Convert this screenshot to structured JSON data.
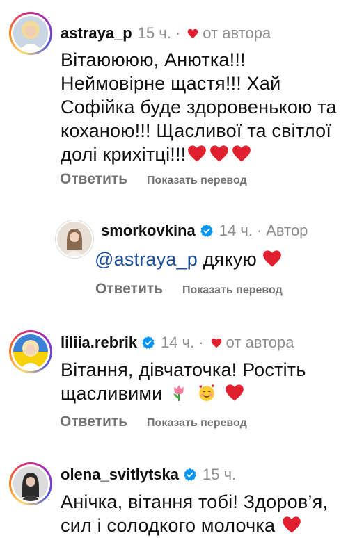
{
  "comments": [
    {
      "username": "astraya_p",
      "verified": false,
      "time": "15 ч.",
      "separator": "·",
      "tag": "от автора",
      "lines": [
        "Вітаюююю, Анютка!!!",
        "Неймовірне щастя!!! Хай",
        "Софійка буде здоровенькою та",
        "коханою!!! Щасливої та світлої",
        "долі крихітці!!!"
      ],
      "reply_label": "Ответить",
      "translate_label": "Показать перевод"
    },
    {
      "username": "smorkovkina",
      "verified": true,
      "time": "14 ч.",
      "separator": "·",
      "tag": "Автор",
      "mention": "@astraya_p",
      "text": "дякую",
      "reply_label": "Ответить",
      "translate_label": "Показать перевод"
    },
    {
      "username": "liliia.rebrik",
      "verified": true,
      "time": "14 ч.",
      "separator": "·",
      "tag": "от автора",
      "lines": [
        "Вітання, дівчаточка! Ростіть",
        "щасливими"
      ],
      "reply_label": "Ответить",
      "translate_label": "Показать перевод"
    },
    {
      "username": "olena_svitlytska",
      "verified": true,
      "time": "15 ч.",
      "lines": [
        "Анічка, вітання тобі! Здоров’я,",
        "сил і солодкого молочка"
      ]
    }
  ],
  "colors": {
    "heart": "#e0202e",
    "verified": "#0095f6",
    "mention": "#1b4f9c",
    "muted": "#8e8e8e"
  },
  "icons": {
    "heart": "heart-icon",
    "verified": "verified-badge-icon",
    "tulip": "tulip-emoji-icon",
    "smiling_hearts": "smiling-face-with-hearts-icon"
  }
}
